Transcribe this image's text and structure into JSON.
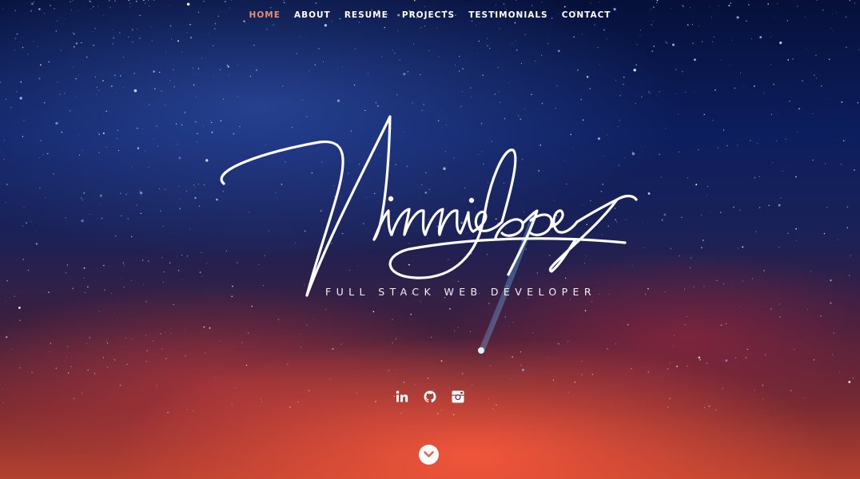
{
  "nav": {
    "items": [
      {
        "label": "HOME",
        "active": true
      },
      {
        "label": "ABOUT",
        "active": false
      },
      {
        "label": "RESUME",
        "active": false
      },
      {
        "label": "PROJECTS",
        "active": false
      },
      {
        "label": "TESTIMONIALS",
        "active": false
      },
      {
        "label": "CONTACT",
        "active": false
      }
    ],
    "active_color": "#e58f6c"
  },
  "hero": {
    "signature": "Vinnie Lopez",
    "tagline": "FULL STACK WEB DEVELOPER"
  },
  "social": {
    "icons": [
      "linkedin-icon",
      "github-icon",
      "instagram-icon"
    ]
  },
  "scroll_button": {
    "icon": "chevron-down-icon",
    "icon_color": "#e2664e"
  }
}
